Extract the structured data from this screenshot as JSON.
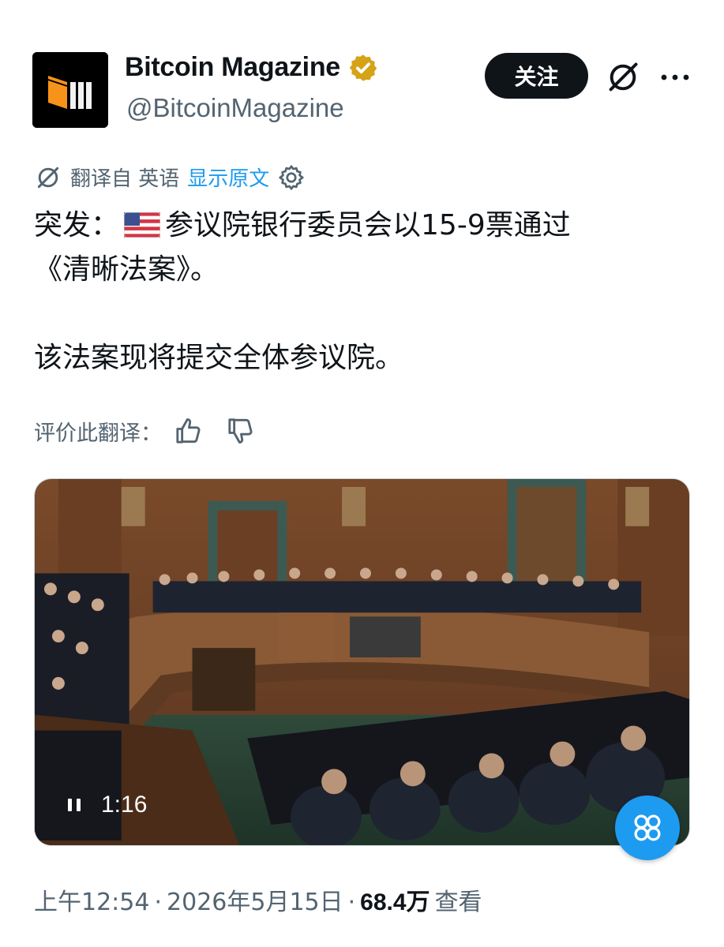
{
  "author": {
    "name": "Bitcoin Magazine",
    "handle": "@BitcoinMagazine",
    "verified": true,
    "verified_color": "#d6a317"
  },
  "actions": {
    "follow_label": "关注",
    "grok_icon": "slashed-circle-icon",
    "more_icon": "more-dots-icon"
  },
  "translation": {
    "label": "翻译自 英语",
    "show_original": "显示原文",
    "rate_label": "评价此翻译："
  },
  "tweet": {
    "line1_prefix": "突发：",
    "line1_flag": "us-flag-emoji",
    "line1_text": "参议院银行委员会以15-9票通过",
    "line2": "《清晰法案》。",
    "line3": "该法案现将提交全体参议院。"
  },
  "media": {
    "type": "video",
    "duration": "1:16",
    "state": "playing"
  },
  "meta": {
    "time": "上午12:54",
    "separator": "·",
    "date": "2026年5月15日",
    "views_count": "68.4万",
    "views_label": "查看"
  },
  "colors": {
    "accent": "#1d9bf0",
    "text_primary": "#0f1419",
    "text_secondary": "#536471"
  }
}
